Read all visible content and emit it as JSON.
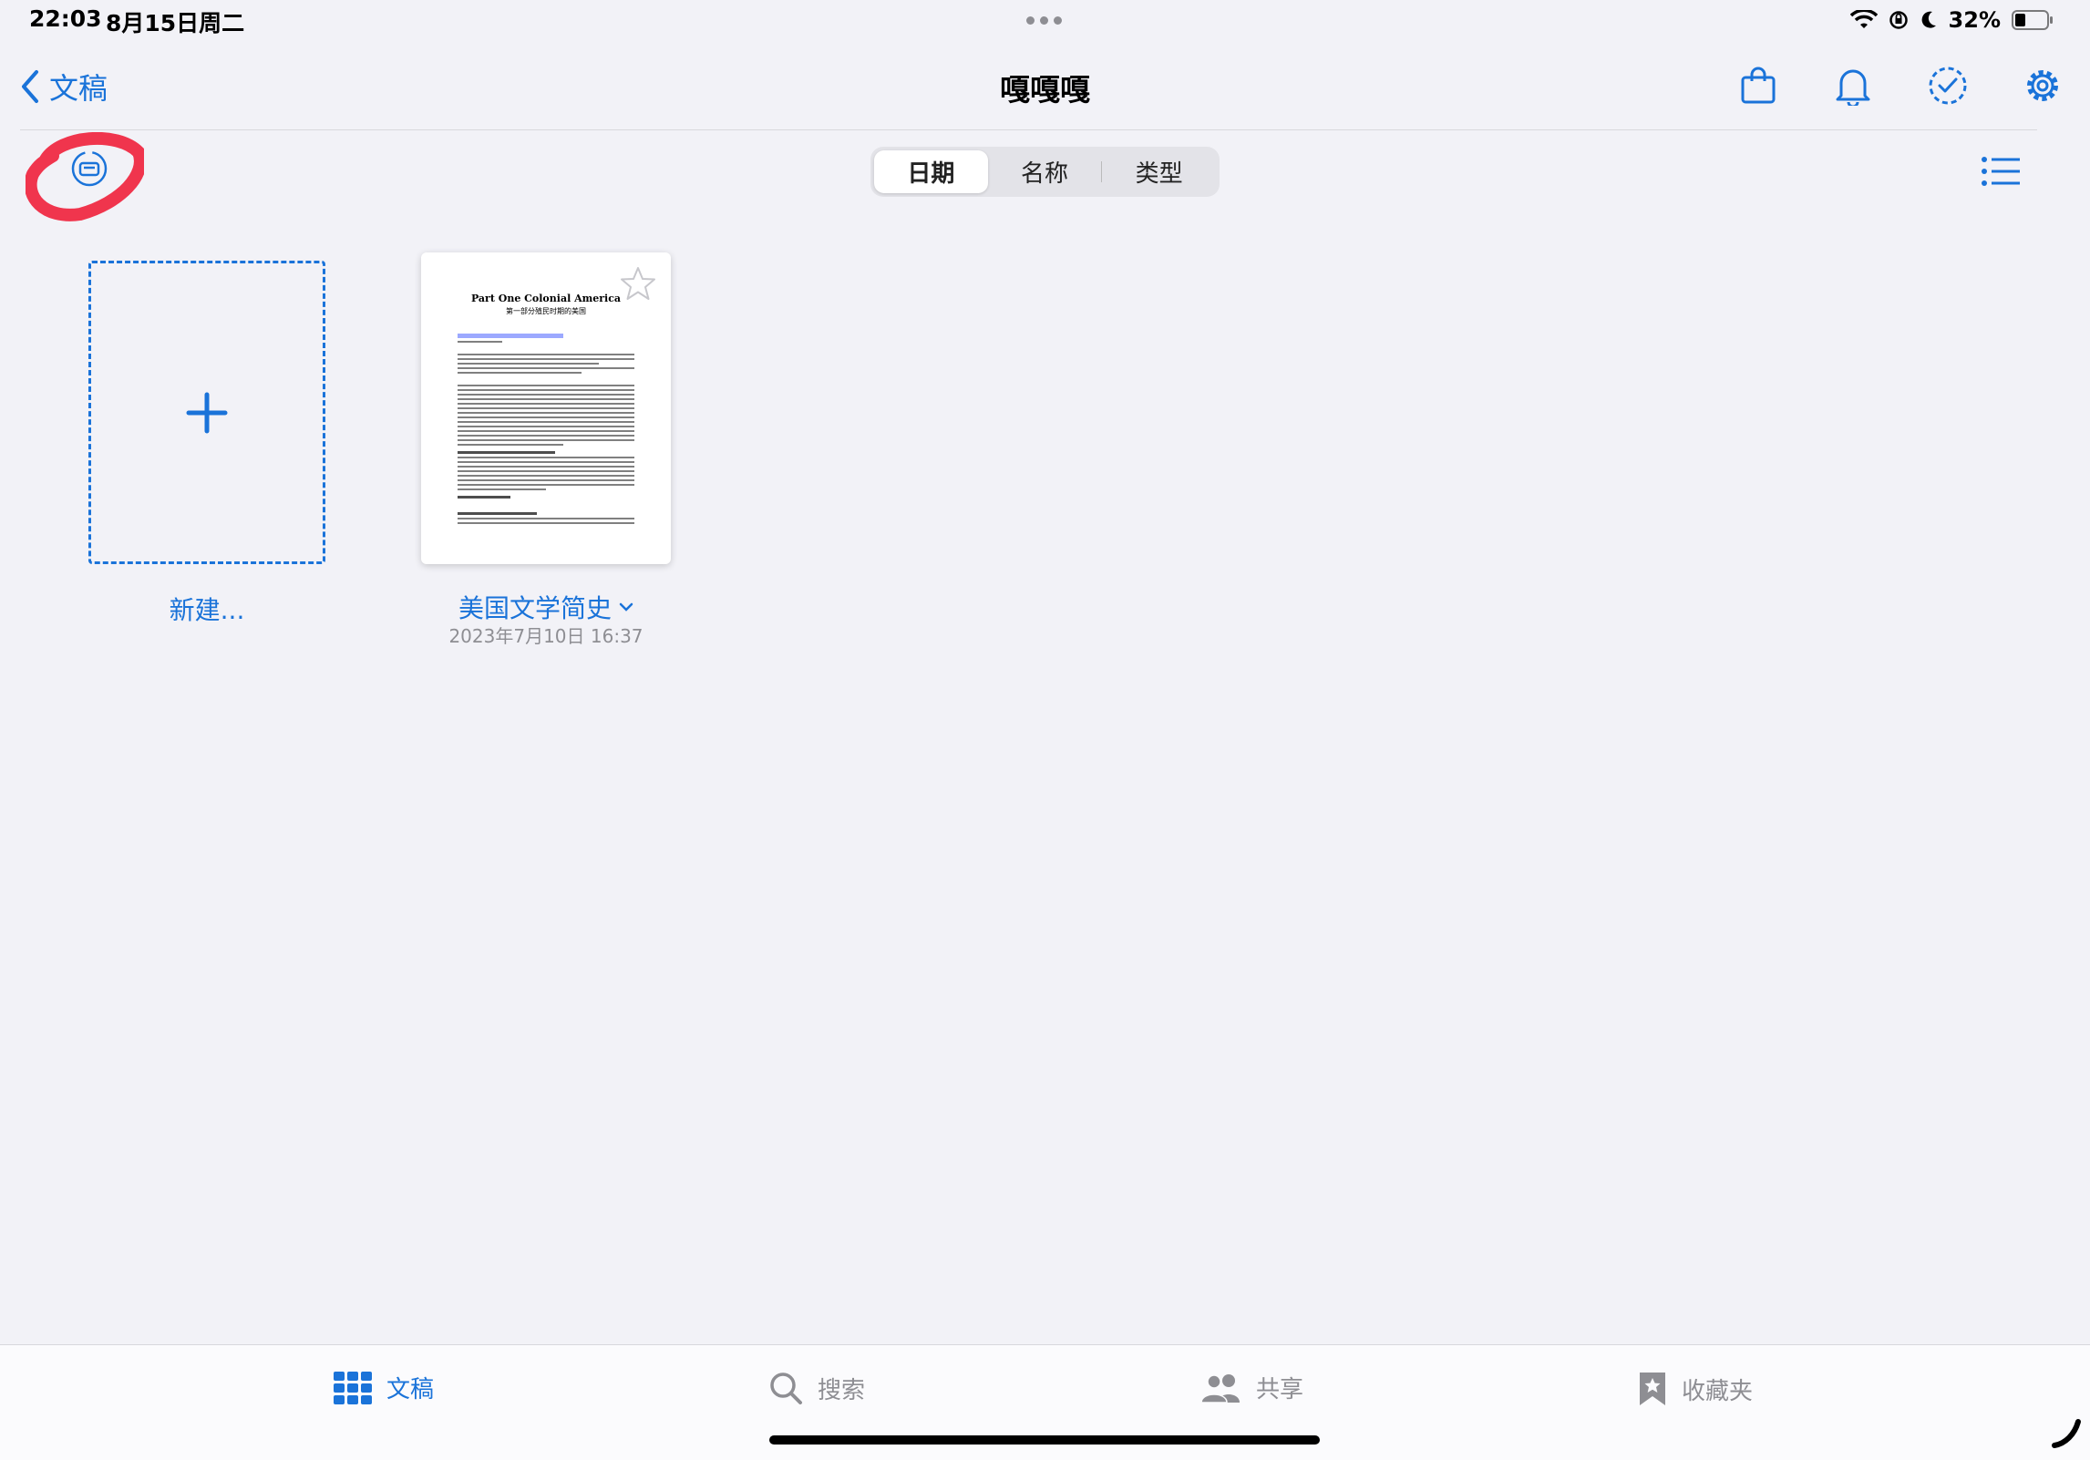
{
  "status": {
    "time": "22:03",
    "date": "8月15日周二",
    "battery": "32%",
    "battery_level": 0.32
  },
  "nav": {
    "back_label": "文稿",
    "title": "嘎嘎嘎"
  },
  "sort": {
    "options": [
      "日期",
      "名称",
      "类型"
    ],
    "selected": "日期"
  },
  "grid": {
    "new_label": "新建...",
    "document": {
      "name": "美国文学简史",
      "date": "2023年7月10日 16:37",
      "thumb_title": "Part One Colonial America",
      "thumb_subtitle": "第一部分殖民时期的美国"
    }
  },
  "tabs": {
    "documents": "文稿",
    "search": "搜索",
    "shared": "共享",
    "favorites": "收藏夹"
  },
  "colors": {
    "accent": "#1a73d9",
    "annotation": "#f0354d",
    "background": "#f2f2f7"
  }
}
